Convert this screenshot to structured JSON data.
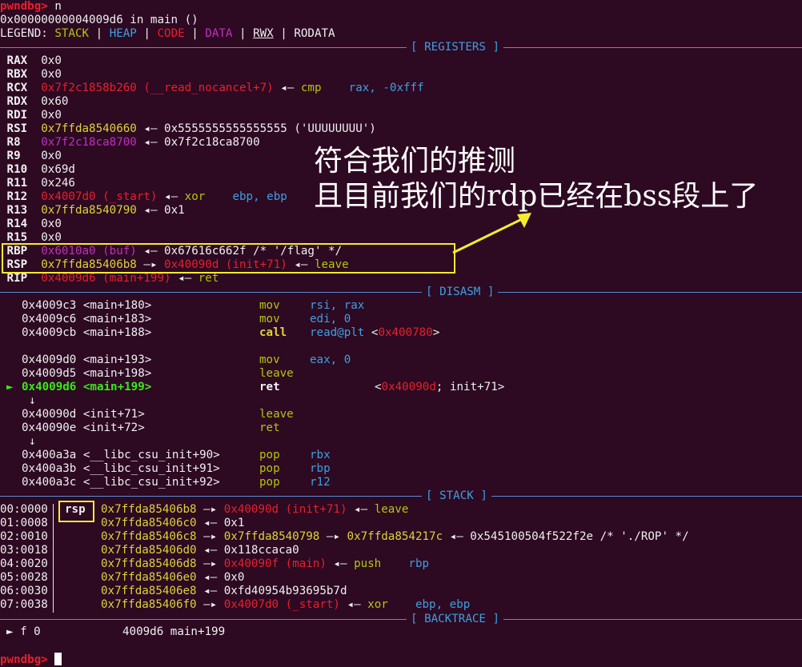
{
  "prompt": {
    "text": "pwndbg>",
    "command": " n"
  },
  "location": "0x00000000004009d6 in main ()",
  "legend": {
    "label": "LEGEND: ",
    "stack": "STACK",
    "heap": "HEAP",
    "code": "CODE",
    "data": "DATA",
    "rwx": "RWX",
    "rodata": "RODATA",
    "sep": " | "
  },
  "sections": {
    "registers": "[ REGISTERS ]",
    "disasm": "[ DISASM ]",
    "stack": "[ STACK ]",
    "backtrace": "[ BACKTRACE ]"
  },
  "registers": [
    {
      "name": "RAX",
      "value": "0x0"
    },
    {
      "name": "RBX",
      "value": "0x0"
    },
    {
      "name": "RCX",
      "value": "0x7f2c1858b260 (__read_nocancel+7)",
      "arrow": " ◂— ",
      "rest": "cmp",
      "rest2": "rax, -0xfff"
    },
    {
      "name": "RDX",
      "value": "0x60"
    },
    {
      "name": "RDI",
      "value": "0x0"
    },
    {
      "name": "RSI",
      "value": "0x7ffda8540660",
      "arrow": " ◂— ",
      "rest": "0x5555555555555555 ('UUUUUUUU')"
    },
    {
      "name": "R8",
      "value": "0x7f2c18ca8700",
      "arrow": " ◂— ",
      "rest": "0x7f2c18ca8700"
    },
    {
      "name": "R9",
      "value": "0x0"
    },
    {
      "name": "R10",
      "value": "0x69d"
    },
    {
      "name": "R11",
      "value": "0x246"
    },
    {
      "name": "R12",
      "value": "0x4007d0 (_start)",
      "arrow": " ◂— ",
      "rest": "xor",
      "rest2": "ebp, ebp"
    },
    {
      "name": "R13",
      "value": "0x7ffda8540790",
      "arrow": " ◂— ",
      "rest": "0x1"
    },
    {
      "name": "R14",
      "value": "0x0"
    },
    {
      "name": "R15",
      "value": "0x0"
    },
    {
      "name": "RBP",
      "value": "0x6010a0 (buf)",
      "arrow": " ◂— ",
      "rest": "0x67616c662f /* '/flag' */"
    },
    {
      "name": "RSP",
      "value": "0x7ffda85406b8",
      "arrow": " —▸ ",
      "rest": "0x40090d (init+71)",
      "arrow2": " ◂— ",
      "rest2": "leave"
    },
    {
      "name": "RIP",
      "value": "0x4009d6 (main+199)",
      "arrow": " ◂— ",
      "rest": "ret"
    }
  ],
  "disasm": [
    {
      "addr": "0x4009c3",
      "sym": "<main+180>",
      "op": "mov",
      "args": "rsi, rax"
    },
    {
      "addr": "0x4009c6",
      "sym": "<main+183>",
      "op": "mov",
      "args": "edi, 0"
    },
    {
      "addr": "0x4009cb",
      "sym": "<main+188>",
      "op": "call",
      "args": "read@plt",
      "target": "0x400780"
    },
    {
      "addr": "0x4009d0",
      "sym": "<main+193>",
      "op": "mov",
      "args": "eax, 0"
    },
    {
      "addr": "0x4009d5",
      "sym": "<main+198>",
      "op": "leave",
      "args": ""
    },
    {
      "addr": "0x4009d6",
      "sym": "<main+199>",
      "op": "ret",
      "args": "",
      "target": "0x40090d",
      "target_rest": "; init+71>"
    },
    {
      "addr": "0x40090d",
      "sym": "<init+71>",
      "op": "leave",
      "args": ""
    },
    {
      "addr": "0x40090e",
      "sym": "<init+72>",
      "op": "ret",
      "args": ""
    },
    {
      "addr": "0x400a3a",
      "sym": "<__libc_csu_init+90>",
      "op": "pop",
      "args": "rbx"
    },
    {
      "addr": "0x400a3b",
      "sym": "<__libc_csu_init+91>",
      "op": "pop",
      "args": "rbp"
    },
    {
      "addr": "0x400a3c",
      "sym": "<__libc_csu_init+92>",
      "op": "pop",
      "args": "r12"
    }
  ],
  "current_marker": "►",
  "down_arrow": "↓",
  "stack": [
    {
      "idx": "00:0000",
      "tag": "rsp",
      "addr": "0x7ffda85406b8",
      "a1": " —▸ ",
      "v1": "0x40090d (init+71)",
      "a2": " ◂— ",
      "v2": "leave"
    },
    {
      "idx": "01:0008",
      "addr": "0x7ffda85406c0",
      "a1": " ◂— ",
      "v1": "0x1"
    },
    {
      "idx": "02:0010",
      "addr": "0x7ffda85406c8",
      "a1": " —▸ ",
      "v1": "0x7ffda8540798",
      "a2": " —▸ ",
      "v2": "0x7ffda854217c",
      "a3": " ◂— ",
      "v3": "0x545100504f522f2e /* './ROP' */"
    },
    {
      "idx": "03:0018",
      "addr": "0x7ffda85406d0",
      "a1": " ◂— ",
      "v1": "0x118ccaca0"
    },
    {
      "idx": "04:0020",
      "addr": "0x7ffda85406d8",
      "a1": " —▸ ",
      "v1": "0x40090f (main)",
      "a2": " ◂— ",
      "v2": "push",
      "v3": "rbp"
    },
    {
      "idx": "05:0028",
      "addr": "0x7ffda85406e0",
      "a1": " ◂— ",
      "v1": "0x0"
    },
    {
      "idx": "06:0030",
      "addr": "0x7ffda85406e8",
      "a1": " ◂— ",
      "v1": "0xfd40954b93695b7d"
    },
    {
      "idx": "07:0038",
      "addr": "0x7ffda85406f0",
      "a1": " —▸ ",
      "v1": "0x4007d0 (_start)",
      "a2": " ◂— ",
      "v2": "xor",
      "v3": "ebp, ebp"
    }
  ],
  "backtrace": {
    "marker": "►",
    "frame": "f 0",
    "addr": "4009d6",
    "sym": "main+199"
  },
  "annotation": {
    "line1": "符合我们的推测",
    "line2": "且目前我们的rdp已经在bss段上了"
  },
  "colors": {
    "background": "#2d0922",
    "red": "#e8202a",
    "yellow": "#dcd33a",
    "cyan": "#3ea0e0",
    "magenta": "#c030c0",
    "green": "#b2c70c",
    "highlight": "#f5ec2b"
  }
}
